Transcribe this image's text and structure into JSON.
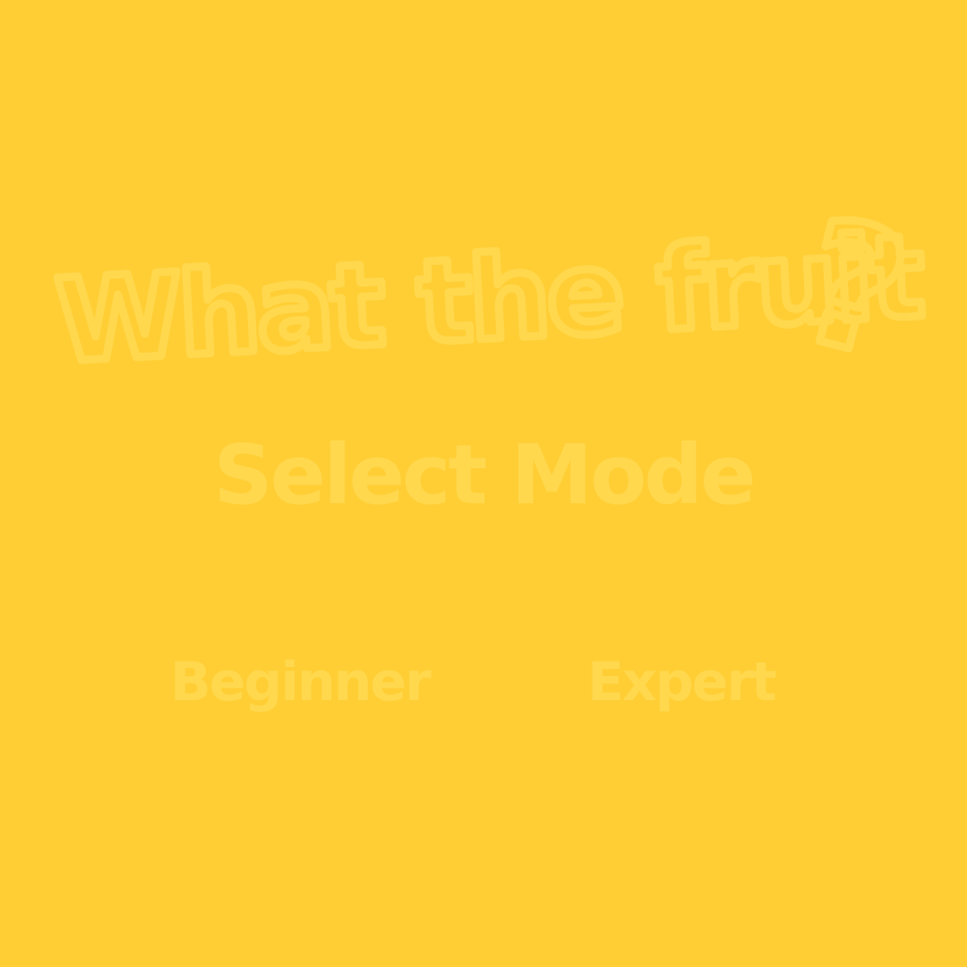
{
  "app": {
    "title": "What the fruit?",
    "title_words": "What the fruit",
    "title_mark": "?"
  },
  "menu": {
    "heading": "Select Mode",
    "modes": [
      {
        "label": "Beginner"
      },
      {
        "label": "Expert"
      }
    ]
  },
  "theme": {
    "background": "#FFCE35",
    "text": "#FFD84E"
  }
}
